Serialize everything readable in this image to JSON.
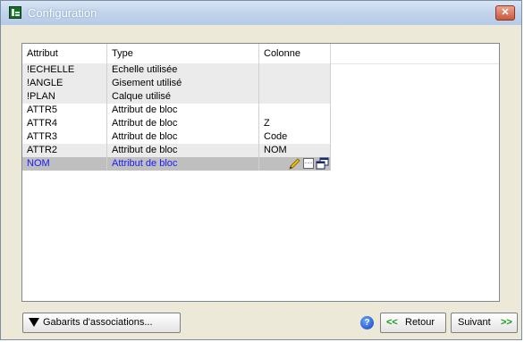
{
  "window": {
    "title": "Configuration",
    "close_label": "✕"
  },
  "table": {
    "columns": [
      "Attribut",
      "Type",
      "Colonne"
    ],
    "rows": [
      {
        "attribut": "!ECHELLE",
        "type": "Echelle utilisée",
        "colonne": ""
      },
      {
        "attribut": "!ANGLE",
        "type": "Gisement utilisé",
        "colonne": ""
      },
      {
        "attribut": "!PLAN",
        "type": "Calque utilisé",
        "colonne": ""
      },
      {
        "attribut": "ATTR5",
        "type": "Attribut de bloc",
        "colonne": ""
      },
      {
        "attribut": "ATTR4",
        "type": "Attribut de bloc",
        "colonne": "Z"
      },
      {
        "attribut": "ATTR3",
        "type": "Attribut de bloc",
        "colonne": "Code"
      },
      {
        "attribut": "ATTR2",
        "type": "Attribut de bloc",
        "colonne": "NOM"
      },
      {
        "attribut": "NOM",
        "type": "Attribut de bloc",
        "colonne": ""
      }
    ],
    "selected_row_icons": [
      "pencil-icon",
      "ellipsis-icon",
      "copy-windows-icon"
    ]
  },
  "footer": {
    "gabarits_label": "Gabarits d'associations...",
    "help_label": "?",
    "retour_label": "Retour",
    "retour_arrow": "<<",
    "suivant_label": "Suivant",
    "suivant_arrow": ">>"
  },
  "colors": {
    "accent_green": "#12a012",
    "selected_text": "#1a1aff"
  }
}
